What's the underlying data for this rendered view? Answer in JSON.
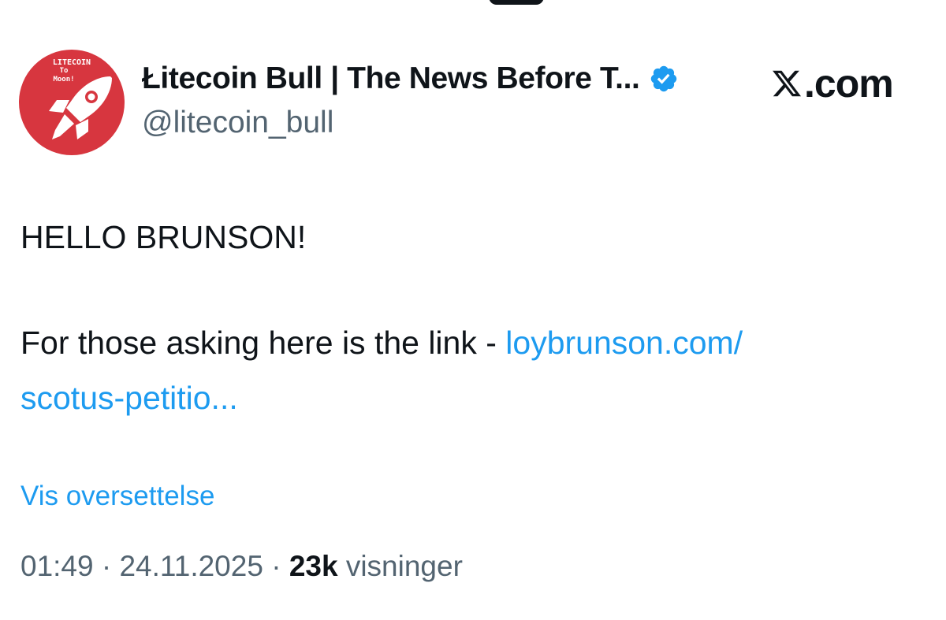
{
  "avatar": {
    "line1": "LITECOIN",
    "line2": "To",
    "line3": "Moon!",
    "background": "#d7363f",
    "icon": "rocket-icon"
  },
  "author": {
    "display_name": "Łitecoin Bull | The News Before T...",
    "handle": "@litecoin_bull",
    "verified_icon": "verified-badge-icon",
    "verified_color": "#1d9bf0"
  },
  "brand": {
    "text": ".com",
    "icon": "x-logo-icon"
  },
  "tweet": {
    "line1": "HELLO BRUNSON!",
    "line2_text": "For those asking here is the link - ",
    "link_part1": "loybrunson.com/",
    "link_part2": "scotus-petitio...",
    "link_color": "#1d9bf0"
  },
  "translate_label": "Vis oversettelse",
  "meta": {
    "time": "01:49",
    "separator": " · ",
    "date": "24.11.2025",
    "views_count": "23k",
    "views_label": "visninger",
    "muted_color": "#536471"
  }
}
